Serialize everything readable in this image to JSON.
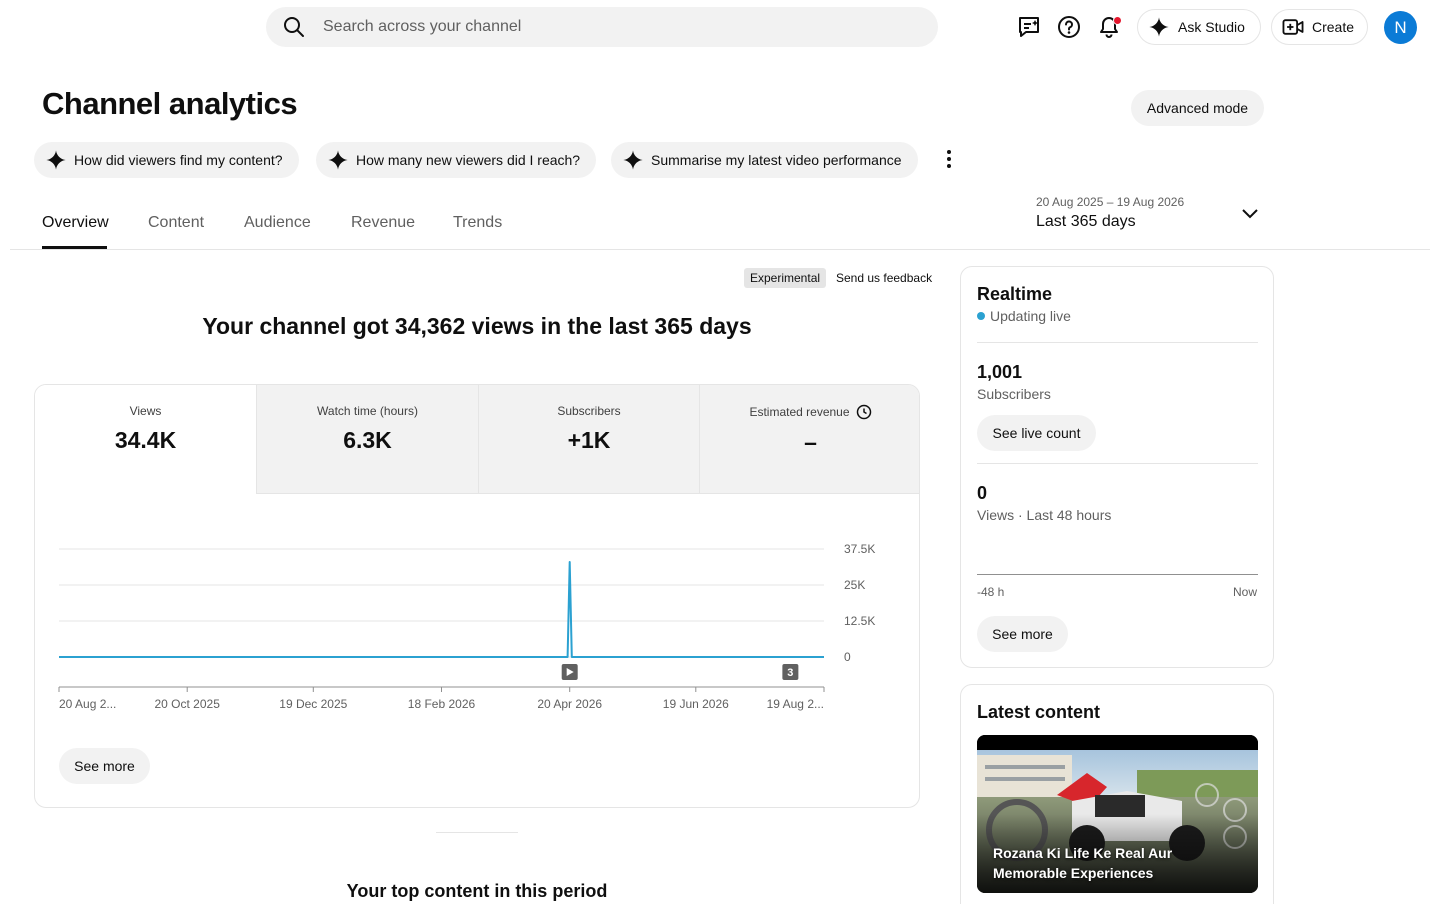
{
  "header": {
    "search_placeholder": "Search across your channel",
    "ask_studio_label": "Ask Studio",
    "create_label": "Create",
    "avatar_initial": "N",
    "accent_color": "#0b7bd6"
  },
  "page": {
    "title": "Channel analytics",
    "advanced_mode_label": "Advanced mode",
    "suggestions": [
      "How did viewers find my content?",
      "How many new viewers did I reach?",
      "Summarise my latest video performance"
    ],
    "tabs": [
      "Overview",
      "Content",
      "Audience",
      "Revenue",
      "Trends"
    ],
    "active_tab": "Overview",
    "date_range": {
      "dates": "20 Aug 2025 – 19 Aug 2026",
      "label": "Last 365 days"
    }
  },
  "overview": {
    "experimental_badge": "Experimental",
    "feedback_link": "Send us feedback",
    "headline": "Your channel got 34,362 views in the last 365 days",
    "metrics": [
      {
        "label": "Views",
        "value": "34.4K",
        "selected": true
      },
      {
        "label": "Watch time (hours)",
        "value": "6.3K",
        "selected": false
      },
      {
        "label": "Subscribers",
        "value": "+1K",
        "selected": false
      },
      {
        "label": "Estimated revenue",
        "value": "–",
        "selected": false
      }
    ],
    "see_more_label": "See more",
    "top_content_title": "Your top content in this period"
  },
  "chart_data": {
    "type": "line",
    "series": [
      {
        "values": [
          {
            "x": "20 Aug 2025",
            "y": 0
          },
          {
            "x": "19 Apr 2026",
            "y": 0
          },
          {
            "x": "20 Apr 2026",
            "y": 33000
          },
          {
            "x": "21 Apr 2026",
            "y": 0
          },
          {
            "x": "19 Aug 2026",
            "y": 0
          }
        ]
      }
    ],
    "x_range": [
      "20 Aug 2025",
      "19 Aug 2026"
    ],
    "x_tick_labels": [
      "20 Aug 2...",
      "20 Oct 2025",
      "19 Dec 2025",
      "18 Feb 2026",
      "20 Apr 2026",
      "19 Jun 2026",
      "19 Aug 2..."
    ],
    "x_tick_dates": [
      "20 Aug 2025",
      "20 Oct 2025",
      "19 Dec 2025",
      "18 Feb 2026",
      "20 Apr 2026",
      "19 Jun 2026",
      "19 Aug 2026"
    ],
    "y_ticks": [
      {
        "value": 37500,
        "label": "37.5K"
      },
      {
        "value": 25000,
        "label": "25K"
      },
      {
        "value": 12500,
        "label": "12.5K"
      },
      {
        "value": 0,
        "label": "0"
      }
    ],
    "ylim": [
      0,
      37500
    ],
    "grid": true,
    "line_color": "#2ba1d1",
    "markers": [
      {
        "x": "20 Apr 2026",
        "label": "▶"
      },
      {
        "x": "3 Aug 2026",
        "label": "3"
      }
    ]
  },
  "realtime": {
    "title": "Realtime",
    "status": "Updating live",
    "subscribers_value": "1,001",
    "subscribers_label": "Subscribers",
    "live_count_label": "See live count",
    "views_value": "0",
    "views_label": "Views · Last 48 hours",
    "axis_start": "-48 h",
    "axis_end": "Now",
    "see_more_label": "See more"
  },
  "latest_content": {
    "title": "Latest content",
    "video_title": "Rozana Ki Life Ke Real Aur Memorable Experiences"
  }
}
